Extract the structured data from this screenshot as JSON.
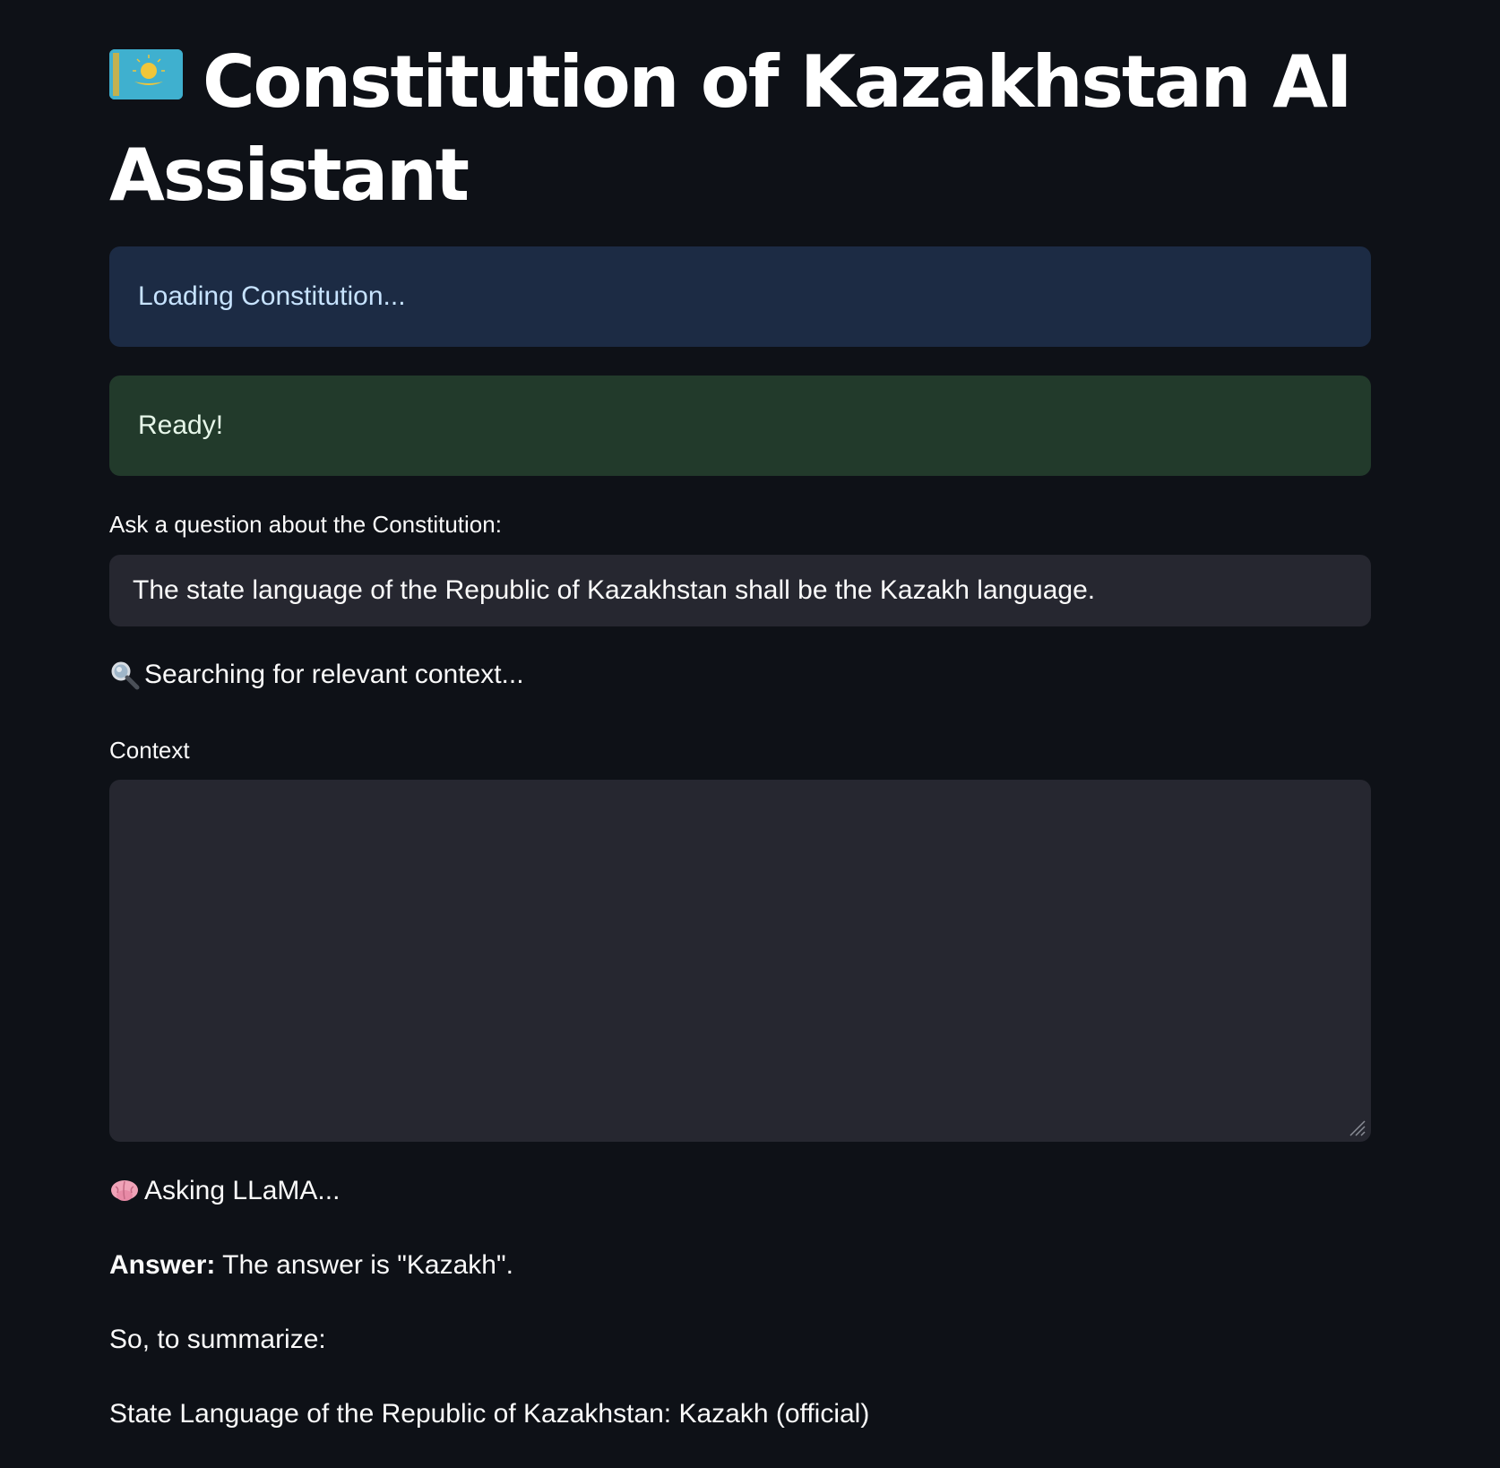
{
  "header": {
    "flag_icon": "kazakhstan-flag-icon",
    "title": "Constitution of Kazakhstan AI Assistant"
  },
  "alerts": {
    "info_text": "Loading Constitution...",
    "success_text": "Ready!",
    "info_color": "#1c2b44",
    "success_color": "#223a2b"
  },
  "question": {
    "label": "Ask a question about the Constitution:",
    "value": "The state language of the Republic of Kazakhstan shall be the Kazakh language."
  },
  "searching": {
    "icon": "magnifier-icon",
    "text": "Searching for relevant context..."
  },
  "context": {
    "label": "Context",
    "value": ""
  },
  "asking": {
    "icon": "brain-icon",
    "text": "Asking LLaMA..."
  },
  "answer": {
    "label": "Answer:",
    "text": "The answer is \"Kazakh\"."
  },
  "summary": {
    "intro": "So, to summarize:",
    "line": "State Language of the Republic of Kazakhstan: Kazakh (official)"
  },
  "colors": {
    "background": "#0e1117",
    "input_background": "#262730",
    "text": "#fafafa"
  }
}
